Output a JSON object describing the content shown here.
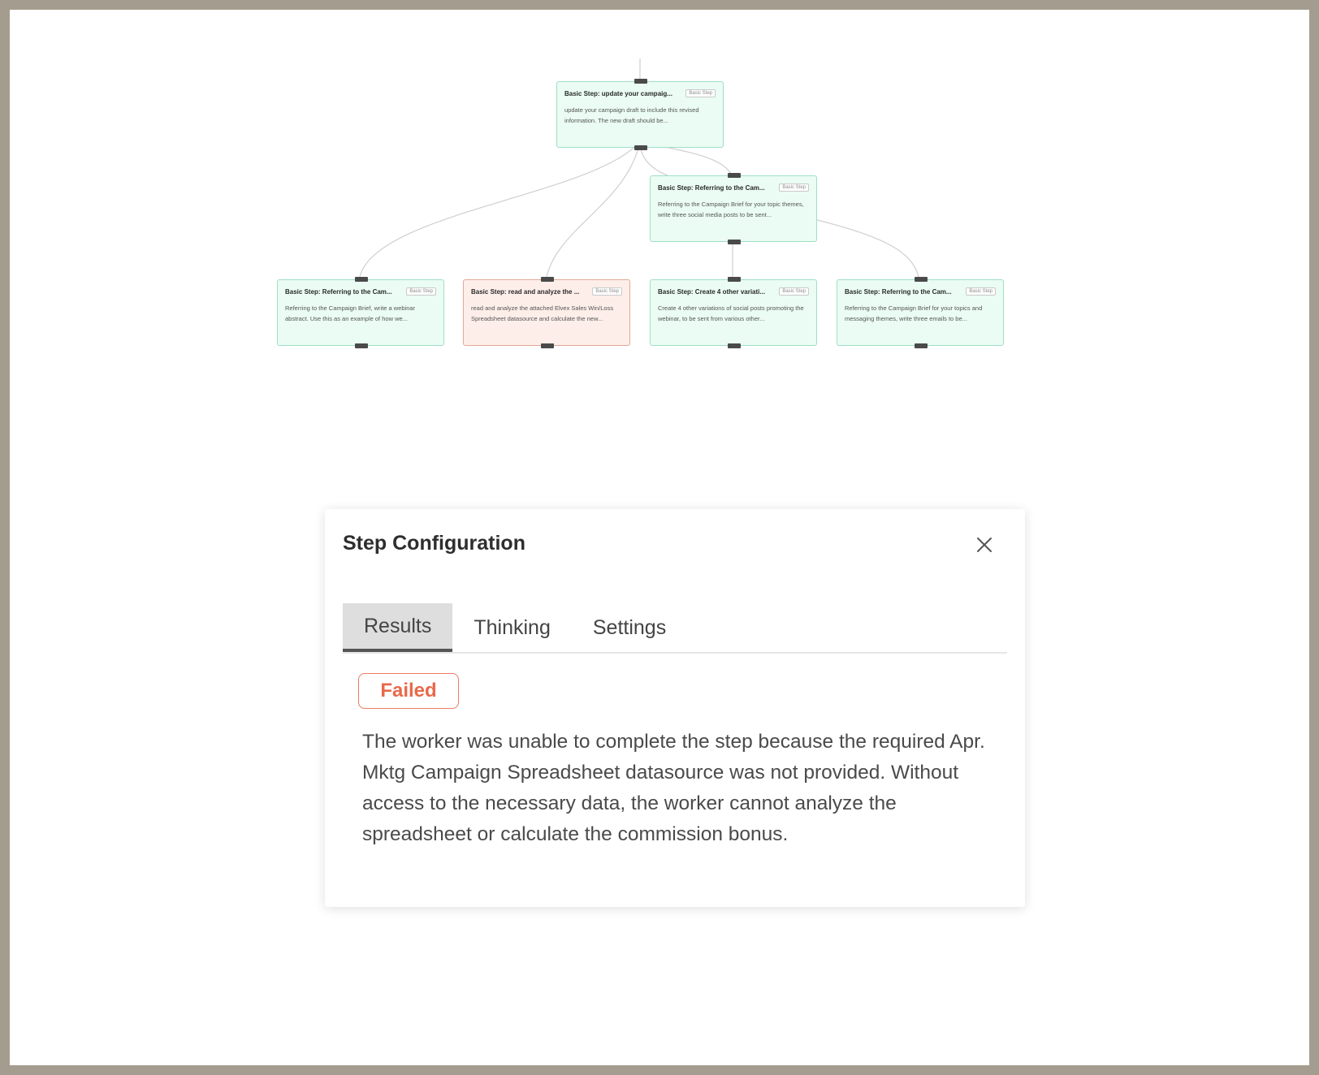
{
  "workflow": {
    "nodes": [
      {
        "id": "n1",
        "status": "pending",
        "title": "Basic Step: update your campaig...",
        "badge": "Basic Step",
        "description": "update your campaign draft to include this revised information. The new draft should be..."
      },
      {
        "id": "n2",
        "status": "pending",
        "title": "Basic Step: Referring to the Cam...",
        "badge": "Basic Step",
        "description": "Referring to the Campaign Brief for your topic themes, write three social media posts to be sent..."
      },
      {
        "id": "n3",
        "status": "pending",
        "title": "Basic Step: Referring to the Cam...",
        "badge": "Basic Step",
        "description": "Referring to the Campaign Brief, write a webinar abstract. Use this as an example of how we..."
      },
      {
        "id": "n4",
        "status": "failed",
        "title": "Basic Step: read and analyze the ...",
        "badge": "Basic Step",
        "description": "read and analyze the attached Elvex Sales Win/Loss Spreadsheet datasource and calculate the new..."
      },
      {
        "id": "n5",
        "status": "pending",
        "title": "Basic Step: Create 4 other variati...",
        "badge": "Basic Step",
        "description": "Create 4 other variations of social posts promoting the webinar, to be sent from various other..."
      },
      {
        "id": "n6",
        "status": "pending",
        "title": "Basic Step: Referring to the Cam...",
        "badge": "Basic Step",
        "description": "Referring to the Campaign Brief for your topics and messaging themes, write three emails to be..."
      }
    ]
  },
  "dialog": {
    "title": "Step Configuration",
    "close_icon": "close-icon",
    "tabs": [
      {
        "label": "Results",
        "active": true
      },
      {
        "label": "Thinking",
        "active": false
      },
      {
        "label": "Settings",
        "active": false
      }
    ],
    "status_label": "Failed",
    "result_text": "The worker was unable to complete the step because the required Apr. Mktg Campaign Spreadsheet datasource was not provided. Without access to the necessary data, the worker cannot analyze the spreadsheet or calculate the commission bonus."
  },
  "colors": {
    "node_fill": "#eafcf4",
    "node_border": "#9fe0c4",
    "failed_fill": "#fdeee9",
    "failed_border": "#e2a898",
    "failed_accent": "#e8694b"
  }
}
